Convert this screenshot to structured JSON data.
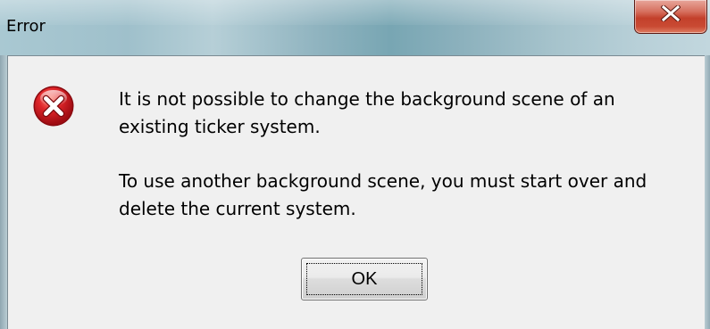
{
  "window": {
    "title": "Error"
  },
  "titlebar": {
    "close_icon": "close-icon",
    "close_color": "#c3402b"
  },
  "dialog": {
    "icon": "error-icon",
    "icon_color": "#c8141e",
    "message_lines": [
      "It is not possible to change the background scene of an",
      "existing ticker system.",
      "To use another background scene, you must start over and",
      "delete the current system."
    ],
    "ok_label": "OK"
  }
}
